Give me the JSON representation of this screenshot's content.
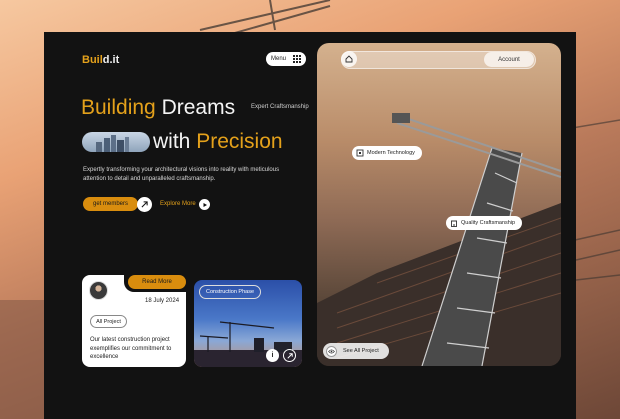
{
  "brand": {
    "logo_part1": "Buil",
    "logo_part2": "d.it"
  },
  "header": {
    "menu_label": "Menu",
    "account_label": "Account"
  },
  "hero": {
    "line1_accent": "Building",
    "line1_rest": "Dreams",
    "tagline": "Expert Craftsmanship",
    "line2_prefix": "with",
    "line2_accent": "Precision",
    "description": "Expertly transforming your architectural visions into reality with meticulous attention to detail and unparalleled craftsmanship."
  },
  "actions": {
    "members_label": "get members",
    "explore_label": "Explore More"
  },
  "project_card": {
    "read_more": "Read More",
    "date": "18 July 2024",
    "all_project": "All Project",
    "text": "Our latest construction project exemplifies our commitment to excellence"
  },
  "photo_card": {
    "phase_label": "Construction Phase",
    "info_symbol": "i"
  },
  "tags": {
    "modern_technology": "Modern Technology",
    "quality_craftsmanship": "Quality Craftsmanship"
  },
  "see_all": "See All Project",
  "colors": {
    "accent": "#e4a11b",
    "button": "#d98d0e",
    "dark": "#121212"
  }
}
